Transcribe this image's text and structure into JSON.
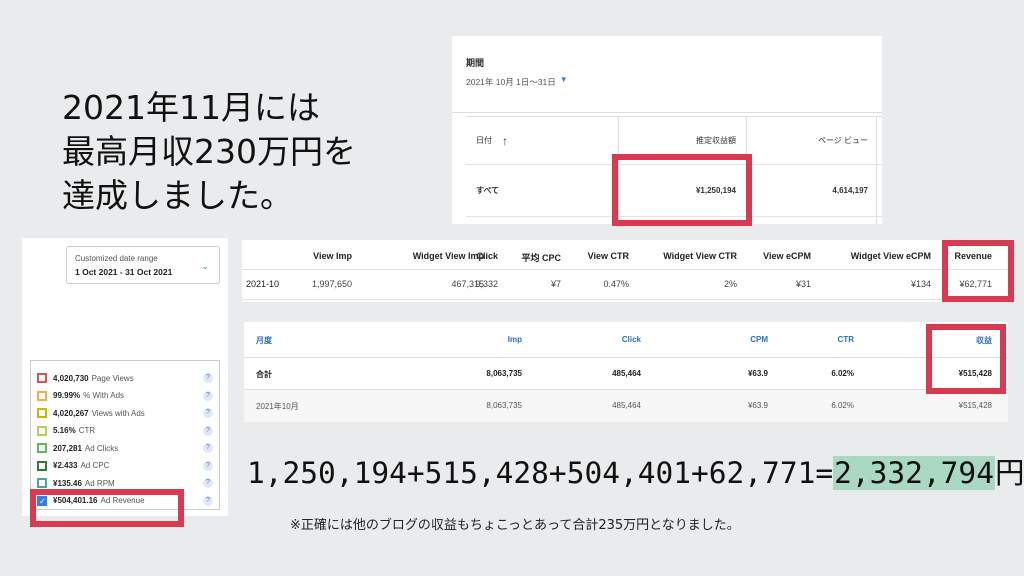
{
  "headline": [
    "2021年11月には",
    "最高月収230万円を",
    "達成しました。"
  ],
  "panel_a": {
    "period_label": "期間",
    "period_value": "2021年 10月 1日〜31日",
    "headers": [
      "日付",
      "推定収益額",
      "ページ ビュー"
    ],
    "sort_icon": "arrow-up-icon",
    "row": [
      "すべて",
      "¥1,250,194",
      "4,614,197"
    ]
  },
  "panel_b": {
    "date_title": "Customized date range",
    "date_value": "1 Oct 2021 - 31 Oct 2021",
    "metrics": [
      {
        "value": "4,020,730",
        "label": "Page Views",
        "color": "#d9534f"
      },
      {
        "value": "99.99%",
        "label": "% With Ads",
        "color": "#f0ad4e"
      },
      {
        "value": "4,020,267",
        "label": "Views with Ads",
        "color": "#c9b800"
      },
      {
        "value": "5.16%",
        "label": "CTR",
        "color": "#b5cf56"
      },
      {
        "value": "207,281",
        "label": "Ad Clicks",
        "color": "#5cb85c"
      },
      {
        "value": "¥2.433",
        "label": "Ad CPC",
        "color": "#2e7d32"
      },
      {
        "value": "¥135.46",
        "label": "Ad RPM",
        "color": "#4aa89a"
      },
      {
        "value": "¥504,401.16",
        "label": "Ad Revenue",
        "color": "#2f80ed"
      }
    ],
    "help_label": "?"
  },
  "panel_c": {
    "headers": [
      "View Imp",
      "Widget View Imp",
      "Click",
      "平均 CPC",
      "View CTR",
      "Widget View CTR",
      "View eCPM",
      "Widget View eCPM",
      "Revenue"
    ],
    "row_label": "2021-10",
    "row": [
      "1,997,650",
      "467,315",
      "9,332",
      "¥7",
      "0.47%",
      "2%",
      "¥31",
      "¥134",
      "¥62,771"
    ]
  },
  "panel_d": {
    "headers": [
      "月度",
      "Imp",
      "Click",
      "CPM",
      "CTR",
      "収益"
    ],
    "rows": [
      [
        "合計",
        "8,063,735",
        "485,464",
        "¥63.9",
        "6.02%",
        "¥515,428"
      ],
      [
        "2021年10月",
        "8,063,735",
        "485,464",
        "¥63.9",
        "6.02%",
        "¥515,428"
      ]
    ]
  },
  "equation": {
    "left": "1,250,194+515,428+504,401+62,771=",
    "total": "2,332,794",
    "unit": "円"
  },
  "note": "※正確には他のブログの収益もちょこっとあって合計235万円となりました。",
  "colors": {
    "highlight": "#d93a52",
    "marker": "#a9d9c2",
    "link_blue": "#2f80ed"
  }
}
